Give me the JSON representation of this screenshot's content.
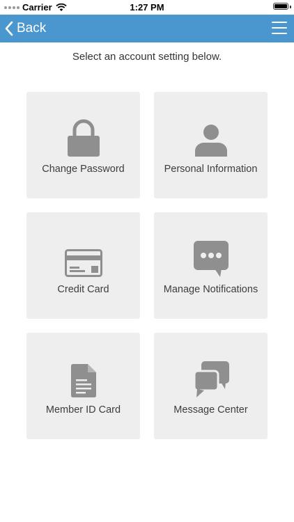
{
  "status_bar": {
    "carrier": "Carrier",
    "time": "1:27 PM"
  },
  "nav": {
    "back_label": "Back",
    "accent_color": "#4a97d0"
  },
  "instruction": "Select an account setting below.",
  "tiles": [
    {
      "label": "Change Password",
      "icon": "lock-icon"
    },
    {
      "label": "Personal Information",
      "icon": "person-icon"
    },
    {
      "label": "Credit Card",
      "icon": "credit-card-icon"
    },
    {
      "label": "Manage Notifications",
      "icon": "chat-bubble-icon"
    },
    {
      "label": "Member ID Card",
      "icon": "document-icon"
    },
    {
      "label": "Message Center",
      "icon": "messages-icon"
    }
  ]
}
